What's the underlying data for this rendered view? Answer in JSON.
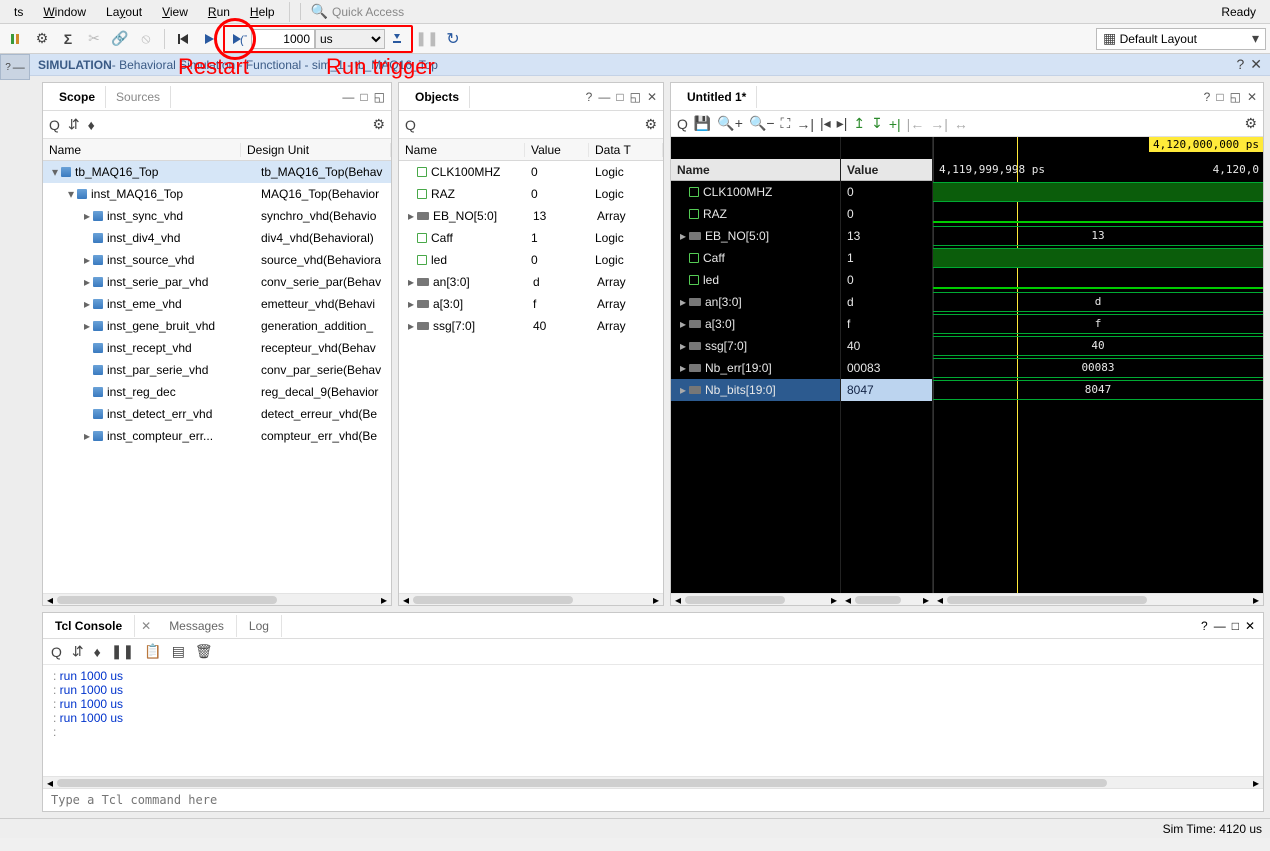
{
  "menu": {
    "items": [
      "ts",
      "Window",
      "Layout",
      "View",
      "Run",
      "Help"
    ],
    "quick_access": "Quick Access",
    "ready": "Ready"
  },
  "toolbar": {
    "run_value": "1000",
    "run_unit": "us",
    "layout_label": "Default Layout"
  },
  "annotations": {
    "restart": "Restart",
    "runtrigger": "Run trigger"
  },
  "simbar": {
    "title": "SIMULATION",
    "subtitle": "- Behavioral Simulation - Functional - sim_1 - tb_MAQ16_Top"
  },
  "scope": {
    "tabs": [
      "Scope",
      "Sources"
    ],
    "hdr": {
      "c1": "Name",
      "c2": "Design Unit"
    },
    "rows": [
      {
        "i": 0,
        "exp": "▾",
        "n": "tb_MAQ16_Top",
        "d": "tb_MAQ16_Top(Behav",
        "sel": true
      },
      {
        "i": 1,
        "exp": "▾",
        "n": "inst_MAQ16_Top",
        "d": "MAQ16_Top(Behavior"
      },
      {
        "i": 2,
        "exp": "▸",
        "n": "inst_sync_vhd",
        "d": "synchro_vhd(Behavio"
      },
      {
        "i": 2,
        "exp": "",
        "n": "inst_div4_vhd",
        "d": "div4_vhd(Behavioral)"
      },
      {
        "i": 2,
        "exp": "▸",
        "n": "inst_source_vhd",
        "d": "source_vhd(Behaviora"
      },
      {
        "i": 2,
        "exp": "▸",
        "n": "inst_serie_par_vhd",
        "d": "conv_serie_par(Behav"
      },
      {
        "i": 2,
        "exp": "▸",
        "n": "inst_eme_vhd",
        "d": "emetteur_vhd(Behavi"
      },
      {
        "i": 2,
        "exp": "▸",
        "n": "inst_gene_bruit_vhd",
        "d": "generation_addition_"
      },
      {
        "i": 2,
        "exp": "",
        "n": "inst_recept_vhd",
        "d": "recepteur_vhd(Behav"
      },
      {
        "i": 2,
        "exp": "",
        "n": "inst_par_serie_vhd",
        "d": "conv_par_serie(Behav"
      },
      {
        "i": 2,
        "exp": "",
        "n": "inst_reg_dec",
        "d": "reg_decal_9(Behavior"
      },
      {
        "i": 2,
        "exp": "",
        "n": "inst_detect_err_vhd",
        "d": "detect_erreur_vhd(Be"
      },
      {
        "i": 2,
        "exp": "▸",
        "n": "inst_compteur_err...",
        "d": "compteur_err_vhd(Be"
      }
    ]
  },
  "objects": {
    "title": "Objects",
    "hdr": {
      "c1": "Name",
      "c2": "Value",
      "c3": "Data T"
    },
    "rows": [
      {
        "exp": "",
        "ic": "sig",
        "n": "CLK100MHZ",
        "v": "0",
        "t": "Logic"
      },
      {
        "exp": "",
        "ic": "sig",
        "n": "RAZ",
        "v": "0",
        "t": "Logic"
      },
      {
        "exp": "▸",
        "ic": "bus",
        "n": "EB_NO[5:0]",
        "v": "13",
        "t": "Array"
      },
      {
        "exp": "",
        "ic": "sig",
        "n": "Caff",
        "v": "1",
        "t": "Logic"
      },
      {
        "exp": "",
        "ic": "sig",
        "n": "led",
        "v": "0",
        "t": "Logic"
      },
      {
        "exp": "▸",
        "ic": "bus",
        "n": "an[3:0]",
        "v": "d",
        "t": "Array"
      },
      {
        "exp": "▸",
        "ic": "bus",
        "n": "a[3:0]",
        "v": "f",
        "t": "Array"
      },
      {
        "exp": "▸",
        "ic": "bus",
        "n": "ssg[7:0]",
        "v": "40",
        "t": "Array"
      }
    ]
  },
  "wave": {
    "title": "Untitled 1*",
    "hdr": {
      "c1": "Name",
      "c2": "Value"
    },
    "time_cursor": "4,120,000,000 ps",
    "t_left": "4,119,999,998 ps",
    "t_right": "4,120,0",
    "signals": [
      {
        "n": "CLK100MHZ",
        "v": "0",
        "ic": "sig",
        "fill": true,
        "mid": ""
      },
      {
        "n": "RAZ",
        "v": "0",
        "ic": "sig",
        "fill": false,
        "mid": ""
      },
      {
        "n": "EB_NO[5:0]",
        "v": "13",
        "ic": "bus",
        "exp": "▸",
        "mid": "13"
      },
      {
        "n": "Caff",
        "v": "1",
        "ic": "sig",
        "fill": true,
        "mid": ""
      },
      {
        "n": "led",
        "v": "0",
        "ic": "sig",
        "fill": false,
        "mid": ""
      },
      {
        "n": "an[3:0]",
        "v": "d",
        "ic": "bus",
        "exp": "▸",
        "mid": "d"
      },
      {
        "n": "a[3:0]",
        "v": "f",
        "ic": "bus",
        "exp": "▸",
        "mid": "f"
      },
      {
        "n": "ssg[7:0]",
        "v": "40",
        "ic": "bus",
        "exp": "▸",
        "mid": "40"
      },
      {
        "n": "Nb_err[19:0]",
        "v": "00083",
        "ic": "bus",
        "exp": "▸",
        "mid": "00083"
      },
      {
        "n": "Nb_bits[19:0]",
        "v": "8047",
        "ic": "bus",
        "exp": "▸",
        "mid": "8047",
        "sel": true
      }
    ]
  },
  "console": {
    "tabs": [
      "Tcl Console",
      "Messages",
      "Log"
    ],
    "lines": [
      "run 1000 us",
      "run 1000 us",
      "run 1000 us",
      "run 1000 us"
    ],
    "placeholder": "Type a Tcl command here"
  },
  "status": {
    "sim_time": "Sim Time: 4120 us"
  }
}
